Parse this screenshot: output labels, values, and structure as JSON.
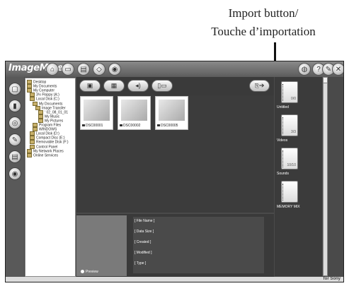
{
  "annotation": {
    "line1": "Import button/",
    "line2": "Touche d’importation"
  },
  "app": {
    "title": "ImageMixer"
  },
  "folder_tree": [
    "Desktop",
    "My Documents",
    "My Computer",
    "3½ Floppy (A:)",
    "Local Disk (C:)",
    "My Documents",
    "Image Transfer",
    "‘ 02_08_01_01",
    "My Music",
    "My Pictures",
    "Program Files",
    "WINDOWS",
    "Local Disk (D:)",
    "Compact Disc (E:)",
    "Removable Disk (F:)",
    "Control Panel",
    "My Network Places",
    "Online Services"
  ],
  "thumbnails": [
    {
      "label": "DSC00001"
    },
    {
      "label": "DSC00002"
    },
    {
      "label": "DSC00005"
    }
  ],
  "preview": {
    "label": "Preview"
  },
  "file_info": [
    "[ File Name ]",
    "[ Data Size ]",
    "[ Created ]",
    "[ Modified ]",
    "[ Type ]"
  ],
  "albums": [
    {
      "count": "0/0",
      "name": "Untitled"
    },
    {
      "count": "3/3",
      "name": "Videos"
    },
    {
      "count": "10/10",
      "name": "Sounds"
    },
    {
      "count": "",
      "name": "MEMORY MIX"
    }
  ],
  "brand": "for Sony"
}
